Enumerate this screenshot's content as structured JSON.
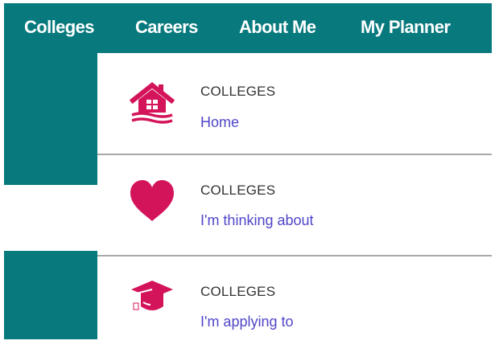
{
  "nav": {
    "items": [
      {
        "label": "Colleges"
      },
      {
        "label": "Careers"
      },
      {
        "label": "About Me"
      },
      {
        "label": "My Planner"
      }
    ]
  },
  "dropdown": {
    "items": [
      {
        "category": "COLLEGES",
        "label": "Home",
        "icon": "house-icon"
      },
      {
        "category": "COLLEGES",
        "label": "I'm thinking about",
        "icon": "heart-icon"
      },
      {
        "category": "COLLEGES",
        "label": "I'm applying to",
        "icon": "graduation-cap-icon"
      }
    ]
  },
  "colors": {
    "nav_background": "#087a7e",
    "nav_text": "#ffffff",
    "icon": "#d4145a",
    "link": "#5046c8",
    "category_text": "#333333",
    "divider": "#a8a8a8"
  }
}
